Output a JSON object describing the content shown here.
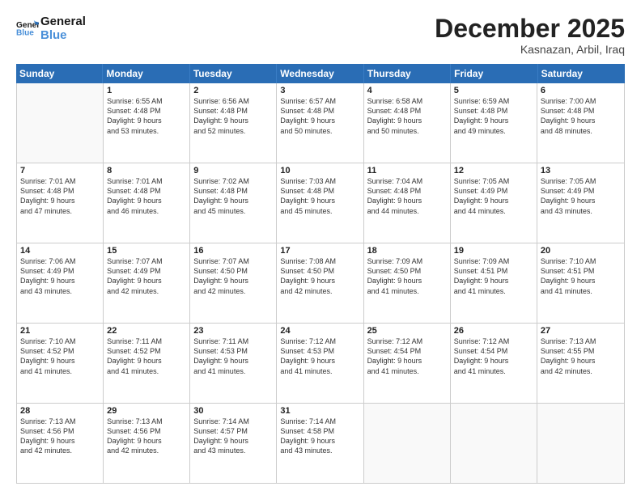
{
  "header": {
    "logo_line1": "General",
    "logo_line2": "Blue",
    "month": "December 2025",
    "location": "Kasnazan, Arbil, Iraq"
  },
  "days_of_week": [
    "Sunday",
    "Monday",
    "Tuesday",
    "Wednesday",
    "Thursday",
    "Friday",
    "Saturday"
  ],
  "weeks": [
    [
      {
        "day": "",
        "lines": []
      },
      {
        "day": "1",
        "lines": [
          "Sunrise: 6:55 AM",
          "Sunset: 4:48 PM",
          "Daylight: 9 hours",
          "and 53 minutes."
        ]
      },
      {
        "day": "2",
        "lines": [
          "Sunrise: 6:56 AM",
          "Sunset: 4:48 PM",
          "Daylight: 9 hours",
          "and 52 minutes."
        ]
      },
      {
        "day": "3",
        "lines": [
          "Sunrise: 6:57 AM",
          "Sunset: 4:48 PM",
          "Daylight: 9 hours",
          "and 50 minutes."
        ]
      },
      {
        "day": "4",
        "lines": [
          "Sunrise: 6:58 AM",
          "Sunset: 4:48 PM",
          "Daylight: 9 hours",
          "and 50 minutes."
        ]
      },
      {
        "day": "5",
        "lines": [
          "Sunrise: 6:59 AM",
          "Sunset: 4:48 PM",
          "Daylight: 9 hours",
          "and 49 minutes."
        ]
      },
      {
        "day": "6",
        "lines": [
          "Sunrise: 7:00 AM",
          "Sunset: 4:48 PM",
          "Daylight: 9 hours",
          "and 48 minutes."
        ]
      }
    ],
    [
      {
        "day": "7",
        "lines": [
          "Sunrise: 7:01 AM",
          "Sunset: 4:48 PM",
          "Daylight: 9 hours",
          "and 47 minutes."
        ]
      },
      {
        "day": "8",
        "lines": [
          "Sunrise: 7:01 AM",
          "Sunset: 4:48 PM",
          "Daylight: 9 hours",
          "and 46 minutes."
        ]
      },
      {
        "day": "9",
        "lines": [
          "Sunrise: 7:02 AM",
          "Sunset: 4:48 PM",
          "Daylight: 9 hours",
          "and 45 minutes."
        ]
      },
      {
        "day": "10",
        "lines": [
          "Sunrise: 7:03 AM",
          "Sunset: 4:48 PM",
          "Daylight: 9 hours",
          "and 45 minutes."
        ]
      },
      {
        "day": "11",
        "lines": [
          "Sunrise: 7:04 AM",
          "Sunset: 4:48 PM",
          "Daylight: 9 hours",
          "and 44 minutes."
        ]
      },
      {
        "day": "12",
        "lines": [
          "Sunrise: 7:05 AM",
          "Sunset: 4:49 PM",
          "Daylight: 9 hours",
          "and 44 minutes."
        ]
      },
      {
        "day": "13",
        "lines": [
          "Sunrise: 7:05 AM",
          "Sunset: 4:49 PM",
          "Daylight: 9 hours",
          "and 43 minutes."
        ]
      }
    ],
    [
      {
        "day": "14",
        "lines": [
          "Sunrise: 7:06 AM",
          "Sunset: 4:49 PM",
          "Daylight: 9 hours",
          "and 43 minutes."
        ]
      },
      {
        "day": "15",
        "lines": [
          "Sunrise: 7:07 AM",
          "Sunset: 4:49 PM",
          "Daylight: 9 hours",
          "and 42 minutes."
        ]
      },
      {
        "day": "16",
        "lines": [
          "Sunrise: 7:07 AM",
          "Sunset: 4:50 PM",
          "Daylight: 9 hours",
          "and 42 minutes."
        ]
      },
      {
        "day": "17",
        "lines": [
          "Sunrise: 7:08 AM",
          "Sunset: 4:50 PM",
          "Daylight: 9 hours",
          "and 42 minutes."
        ]
      },
      {
        "day": "18",
        "lines": [
          "Sunrise: 7:09 AM",
          "Sunset: 4:50 PM",
          "Daylight: 9 hours",
          "and 41 minutes."
        ]
      },
      {
        "day": "19",
        "lines": [
          "Sunrise: 7:09 AM",
          "Sunset: 4:51 PM",
          "Daylight: 9 hours",
          "and 41 minutes."
        ]
      },
      {
        "day": "20",
        "lines": [
          "Sunrise: 7:10 AM",
          "Sunset: 4:51 PM",
          "Daylight: 9 hours",
          "and 41 minutes."
        ]
      }
    ],
    [
      {
        "day": "21",
        "lines": [
          "Sunrise: 7:10 AM",
          "Sunset: 4:52 PM",
          "Daylight: 9 hours",
          "and 41 minutes."
        ]
      },
      {
        "day": "22",
        "lines": [
          "Sunrise: 7:11 AM",
          "Sunset: 4:52 PM",
          "Daylight: 9 hours",
          "and 41 minutes."
        ]
      },
      {
        "day": "23",
        "lines": [
          "Sunrise: 7:11 AM",
          "Sunset: 4:53 PM",
          "Daylight: 9 hours",
          "and 41 minutes."
        ]
      },
      {
        "day": "24",
        "lines": [
          "Sunrise: 7:12 AM",
          "Sunset: 4:53 PM",
          "Daylight: 9 hours",
          "and 41 minutes."
        ]
      },
      {
        "day": "25",
        "lines": [
          "Sunrise: 7:12 AM",
          "Sunset: 4:54 PM",
          "Daylight: 9 hours",
          "and 41 minutes."
        ]
      },
      {
        "day": "26",
        "lines": [
          "Sunrise: 7:12 AM",
          "Sunset: 4:54 PM",
          "Daylight: 9 hours",
          "and 41 minutes."
        ]
      },
      {
        "day": "27",
        "lines": [
          "Sunrise: 7:13 AM",
          "Sunset: 4:55 PM",
          "Daylight: 9 hours",
          "and 42 minutes."
        ]
      }
    ],
    [
      {
        "day": "28",
        "lines": [
          "Sunrise: 7:13 AM",
          "Sunset: 4:56 PM",
          "Daylight: 9 hours",
          "and 42 minutes."
        ]
      },
      {
        "day": "29",
        "lines": [
          "Sunrise: 7:13 AM",
          "Sunset: 4:56 PM",
          "Daylight: 9 hours",
          "and 42 minutes."
        ]
      },
      {
        "day": "30",
        "lines": [
          "Sunrise: 7:14 AM",
          "Sunset: 4:57 PM",
          "Daylight: 9 hours",
          "and 43 minutes."
        ]
      },
      {
        "day": "31",
        "lines": [
          "Sunrise: 7:14 AM",
          "Sunset: 4:58 PM",
          "Daylight: 9 hours",
          "and 43 minutes."
        ]
      },
      {
        "day": "",
        "lines": []
      },
      {
        "day": "",
        "lines": []
      },
      {
        "day": "",
        "lines": []
      }
    ]
  ]
}
